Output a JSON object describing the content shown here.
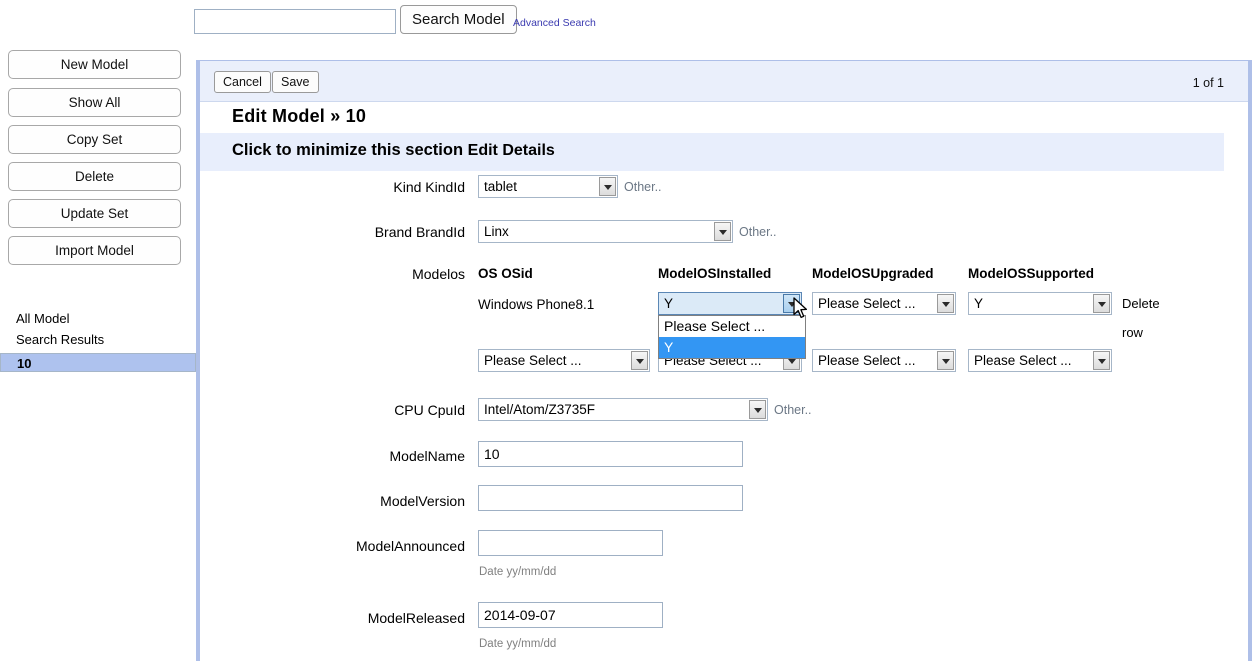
{
  "search": {
    "value": "",
    "placeholder": "",
    "button_label": "Search Model",
    "advanced_label": "Advanced Search"
  },
  "sidebar": {
    "buttons": [
      {
        "label": "New Model"
      },
      {
        "label": "Show All"
      },
      {
        "label": "Copy Set"
      },
      {
        "label": "Delete"
      },
      {
        "label": "Update Set"
      },
      {
        "label": "Import Model"
      }
    ],
    "links": [
      {
        "label": "All Model",
        "selected": false
      },
      {
        "label": "Search Results",
        "selected": false
      },
      {
        "label": "10",
        "selected": true
      }
    ]
  },
  "panel": {
    "toolbar": {
      "cancel_label": "Cancel",
      "save_label": "Save",
      "paging": "1 of 1"
    },
    "page_title": "Edit Model » 10",
    "section_header": {
      "minimize_hint": "Click to minimize this section",
      "title": "Edit Details"
    }
  },
  "form": {
    "kind": {
      "label": "Kind KindId",
      "value": "tablet",
      "other_label": "Other.."
    },
    "brand": {
      "label": "Brand BrandId",
      "value": "Linx",
      "other_label": "Other.."
    },
    "modelos": {
      "label": "Modelos",
      "columns": [
        "OS OSid",
        "ModelOSInstalled",
        "ModelOSUpgraded",
        "ModelOSSupported"
      ],
      "rows": [
        {
          "os": "Windows Phone8.1",
          "installed": "Y",
          "upgraded": "Please Select ...",
          "supported": "Y",
          "action": "Delete row",
          "installed_open": true
        },
        {
          "os": "Please Select ...",
          "installed": "Please Select ...",
          "upgraded": "Please Select ...",
          "supported": "Please Select ...",
          "action": "",
          "installed_open": false
        }
      ],
      "open_dropdown": {
        "options": [
          "Please Select ...",
          "Y"
        ],
        "highlighted": "Y"
      }
    },
    "cpu": {
      "label": "CPU CpuId",
      "value": "Intel/Atom/Z3735F",
      "other_label": "Other.."
    },
    "model_name": {
      "label": "ModelName",
      "value": "10"
    },
    "model_version": {
      "label": "ModelVersion",
      "value": ""
    },
    "model_announced": {
      "label": "ModelAnnounced",
      "value": "",
      "hint": "Date yy/mm/dd"
    },
    "model_released": {
      "label": "ModelReleased",
      "value": "2014-09-07",
      "hint": "Date yy/mm/dd"
    }
  },
  "colors": {
    "panel_border": "#aebfe8",
    "section_band": "#e8eefc",
    "toolbar_band": "#eaeffb",
    "selected_item": "#aec2ee",
    "dropdown_highlight": "#3396f3",
    "link": "#3a3ab0"
  }
}
